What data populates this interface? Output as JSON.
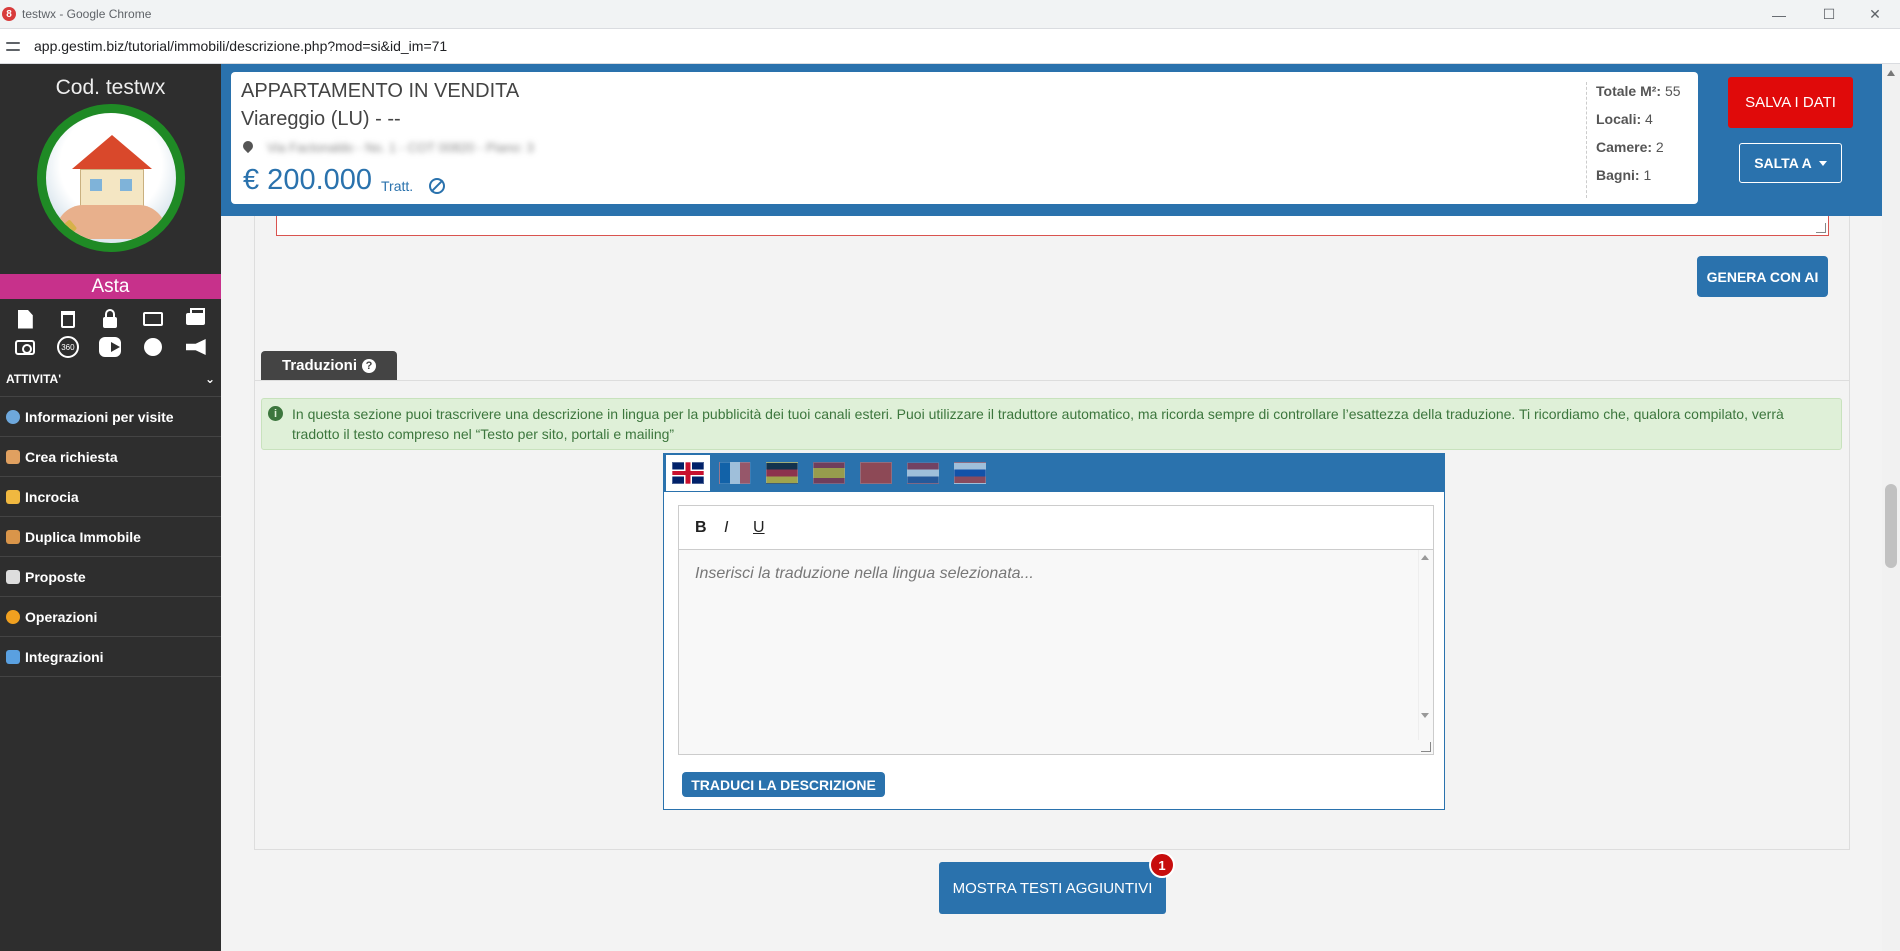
{
  "browser": {
    "title": "testwx - Google Chrome",
    "app_icon": "8",
    "url": "app.gestim.biz/tutorial/immobili/descrizione.php?mod=si&id_im=71",
    "controls": {
      "minimize": "—",
      "maximize": "☐",
      "close": "✕"
    }
  },
  "sidebar": {
    "code": "Cod. testwx",
    "status": "Asta",
    "status_color": "#c7318b",
    "tool_icons_row1": [
      "file-icon",
      "trash-icon",
      "lock-icon",
      "folder-open-icon",
      "print-icon"
    ],
    "tool_icons_row2": [
      "camera-icon",
      "360-icon",
      "youtube-icon",
      "globe-icon",
      "megaphone-icon"
    ],
    "icon_360_label": "360",
    "section": "ATTIVITA'",
    "section_chevron": "⌄",
    "menu": [
      {
        "label": "Informazioni per visite",
        "icon": "clock-icon"
      },
      {
        "label": "Crea richiesta",
        "icon": "request-icon"
      },
      {
        "label": "Incrocia",
        "icon": "match-icon"
      },
      {
        "label": "Duplica Immobile",
        "icon": "duplicate-icon"
      },
      {
        "label": "Proposte",
        "icon": "document-icon"
      },
      {
        "label": "Operazioni",
        "icon": "euro-icon"
      },
      {
        "label": "Integrazioni",
        "icon": "puzzle-icon"
      }
    ]
  },
  "property": {
    "title": "APPARTAMENTO IN VENDITA",
    "location": "Viareggio (LU) - --",
    "address_blurred": "Via Factonaldo - No. 1 - COT 00820 - Piano: 3",
    "price": "€ 200.000",
    "price_note": "Tratt.",
    "stats": [
      {
        "label": "Totale M²:",
        "value": "55"
      },
      {
        "label": "Locali:",
        "value": "4"
      },
      {
        "label": "Camere:",
        "value": "2"
      },
      {
        "label": "Bagni:",
        "value": "1"
      }
    ]
  },
  "actions": {
    "save": "SALVA I DATI",
    "jump": "SALTA A",
    "generate_ai": "GENERA CON AI"
  },
  "translations": {
    "tab_label": "Traduzioni",
    "tab_help": "?",
    "info_icon": "i",
    "info": "In questa sezione puoi trascrivere una descrizione in lingua per la pubblicità dei tuoi canali esteri. Puoi utilizzare il traduttore automatico, ma ricorda sempre di controllare l’esattezza della traduzione. Ti ricordiamo che, qualora compilato, verrà tradotto il testo compreso nel “Testo per sito, portali e mailing”",
    "languages": [
      {
        "code": "en",
        "icon": "flag-uk-icon",
        "active": true
      },
      {
        "code": "fr",
        "icon": "flag-fr-icon",
        "active": false
      },
      {
        "code": "de",
        "icon": "flag-de-icon",
        "active": false
      },
      {
        "code": "es",
        "icon": "flag-es-icon",
        "active": false
      },
      {
        "code": "cn",
        "icon": "flag-cn-icon",
        "active": false
      },
      {
        "code": "nl",
        "icon": "flag-nl-icon",
        "active": false
      },
      {
        "code": "ru",
        "icon": "flag-ru-icon",
        "active": false
      }
    ],
    "toolbar": {
      "bold": "B",
      "italic": "I",
      "underline": "U"
    },
    "placeholder": "Inserisci la traduzione nella lingua selezionata...",
    "translate_button": "TRADUCI LA DESCRIZIONE"
  },
  "more": {
    "label": "MOSTRA TESTI AGGIUNTIVI",
    "badge": "1"
  },
  "colors": {
    "primary": "#2a72ad",
    "danger": "#e00a0a",
    "sidebar_bg": "#2e2e2e",
    "info_bg": "#dff0d8"
  }
}
